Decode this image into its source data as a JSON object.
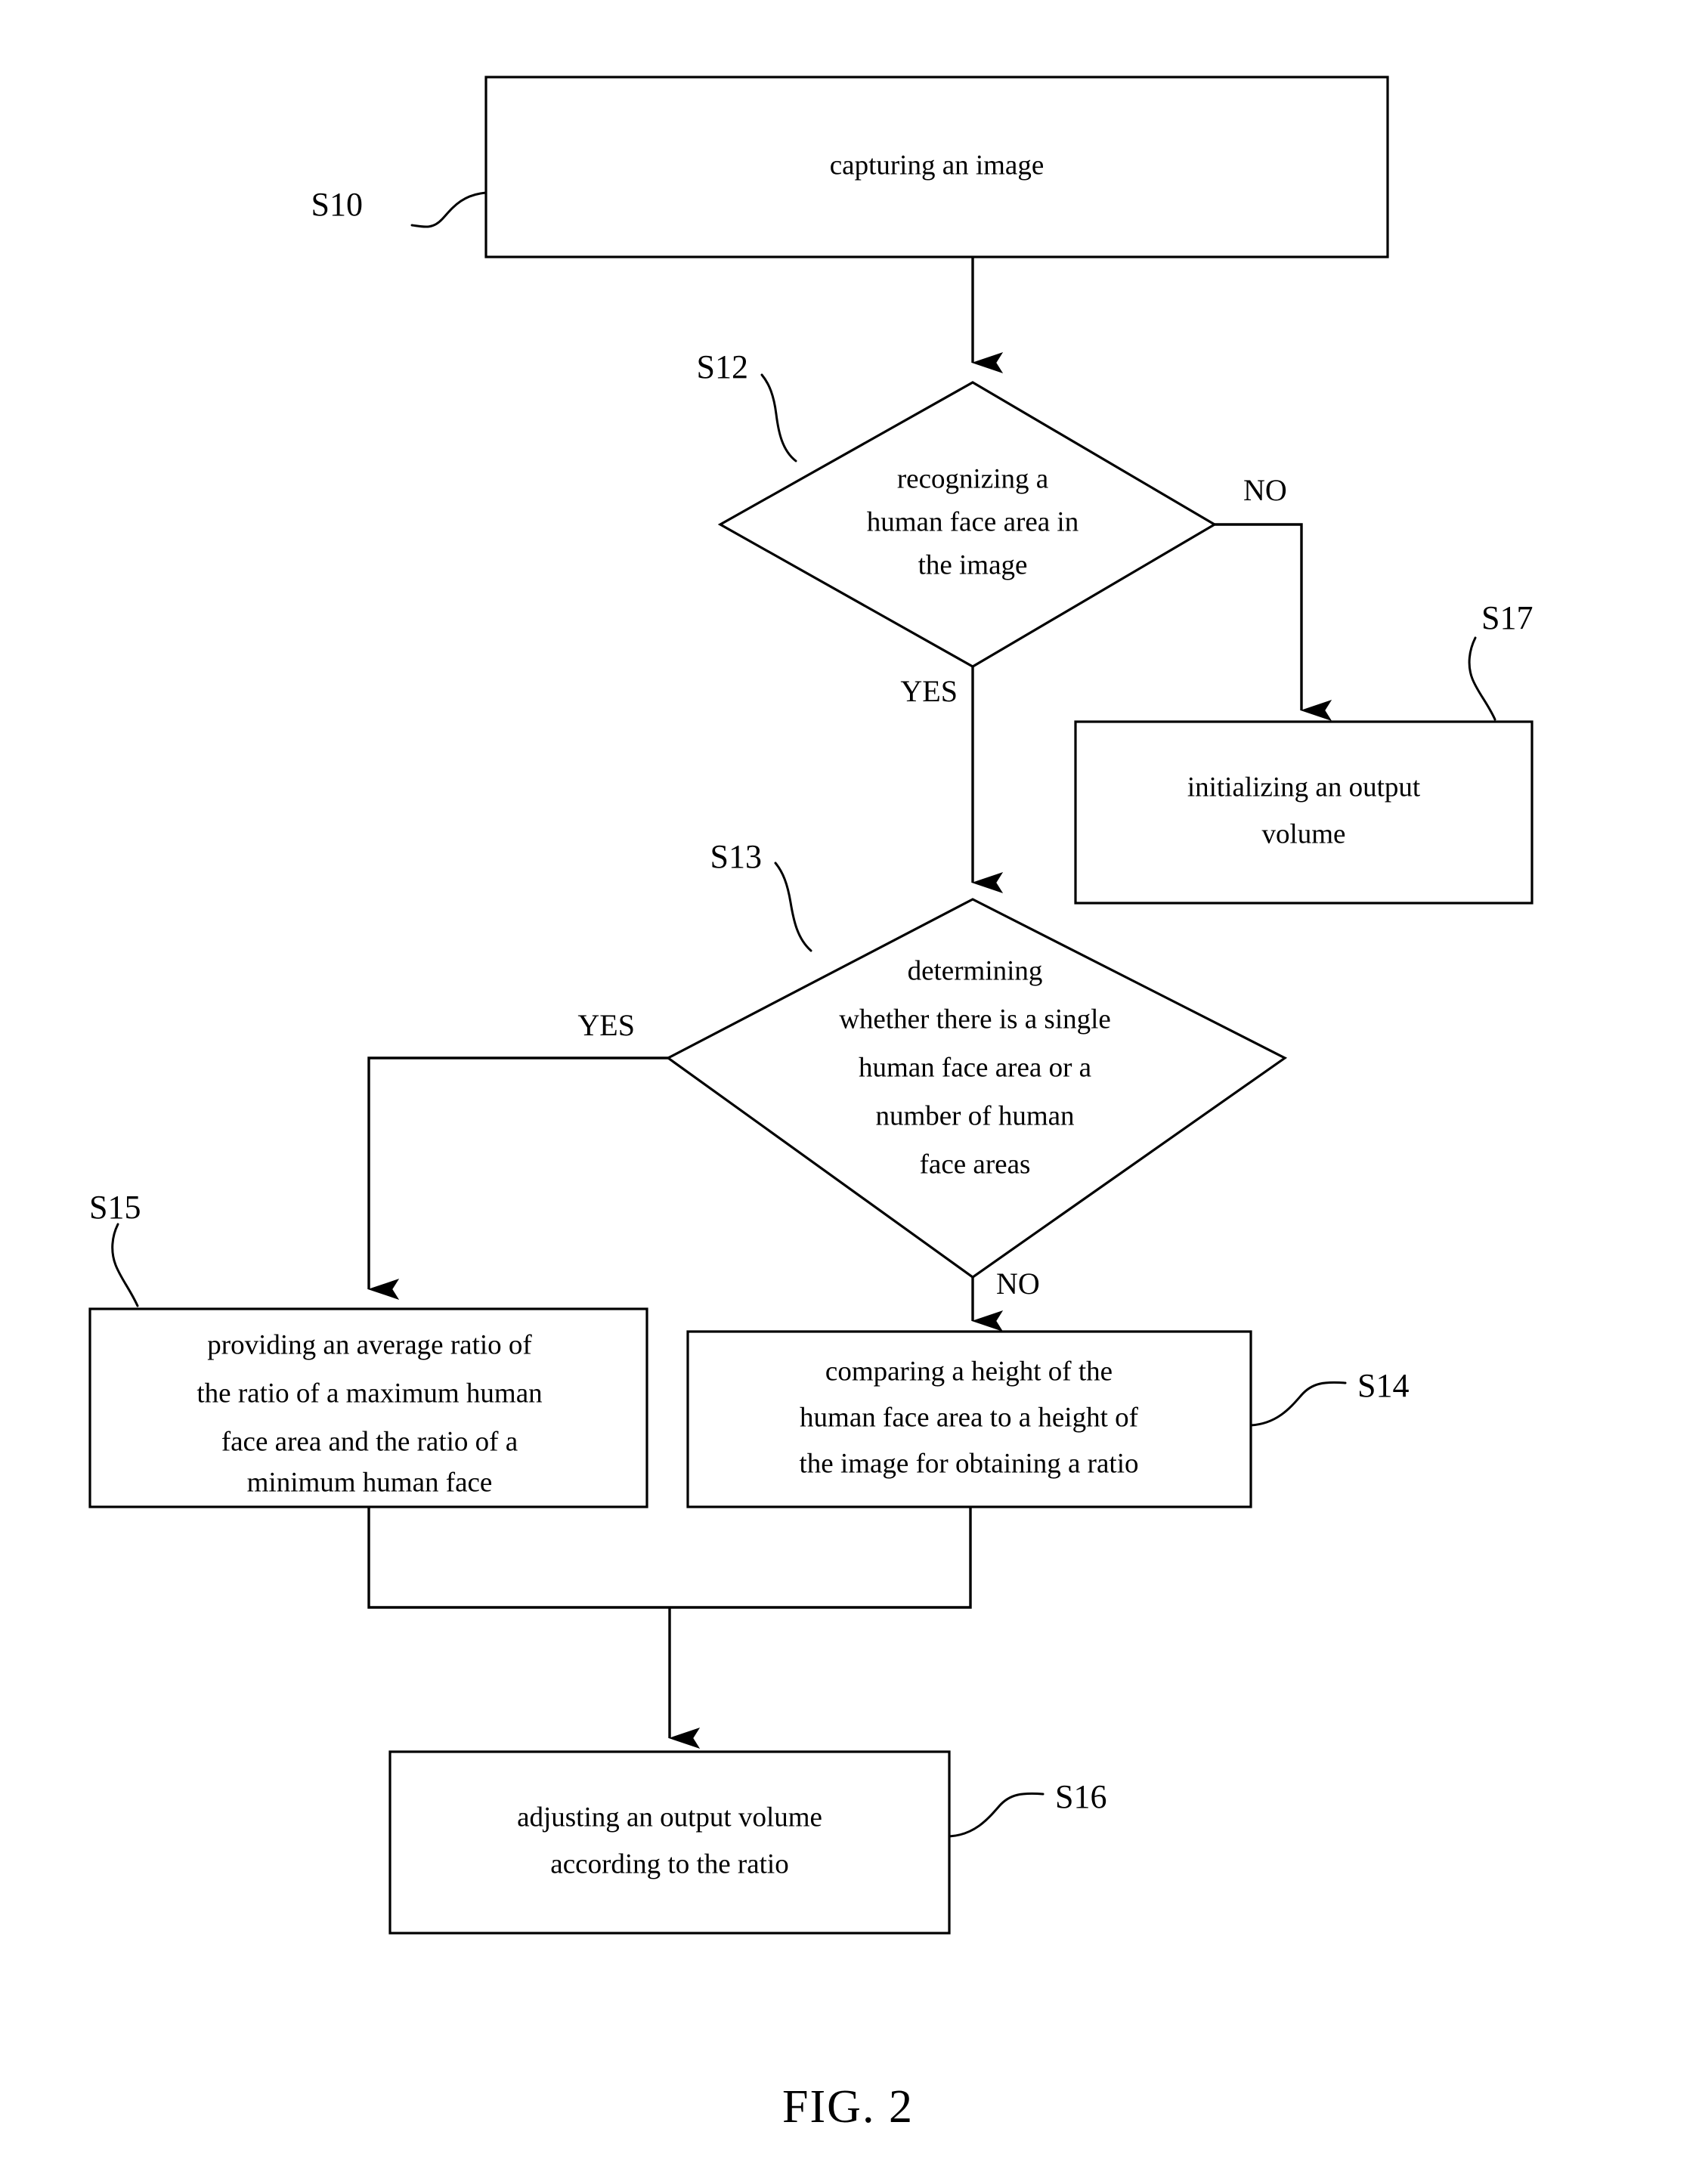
{
  "figure": {
    "caption": "FIG. 2",
    "type": "flowchart"
  },
  "nodes": {
    "s10": {
      "ref": "S10",
      "shape": "rectangle",
      "lines": [
        "capturing an image"
      ]
    },
    "s12": {
      "ref": "S12",
      "shape": "diamond",
      "lines": [
        "recognizing a",
        "human face area in",
        "the image"
      ]
    },
    "s17": {
      "ref": "S17",
      "shape": "rectangle",
      "lines": [
        "initializing an output",
        "volume"
      ]
    },
    "s13": {
      "ref": "S13",
      "shape": "diamond",
      "lines": [
        "determining",
        "whether there is a single",
        "human face area or a",
        "number of human",
        "face areas"
      ]
    },
    "s15": {
      "ref": "S15",
      "shape": "rectangle",
      "lines": [
        "providing an average ratio of",
        "the ratio of a maximum human",
        "face area and the ratio of a",
        "minimum human face"
      ]
    },
    "s14": {
      "ref": "S14",
      "shape": "rectangle",
      "lines": [
        "comparing a height of the",
        "human face area to a height of",
        "the image for obtaining a ratio"
      ]
    },
    "s16": {
      "ref": "S16",
      "shape": "rectangle",
      "lines": [
        "adjusting an output volume",
        "according to the ratio"
      ]
    }
  },
  "branch_labels": {
    "s12_no": "NO",
    "s12_yes": "YES",
    "s13_yes": "YES",
    "s13_no": "NO"
  },
  "colors": {
    "stroke": "#000000",
    "fill": "#ffffff",
    "text": "#000000"
  }
}
